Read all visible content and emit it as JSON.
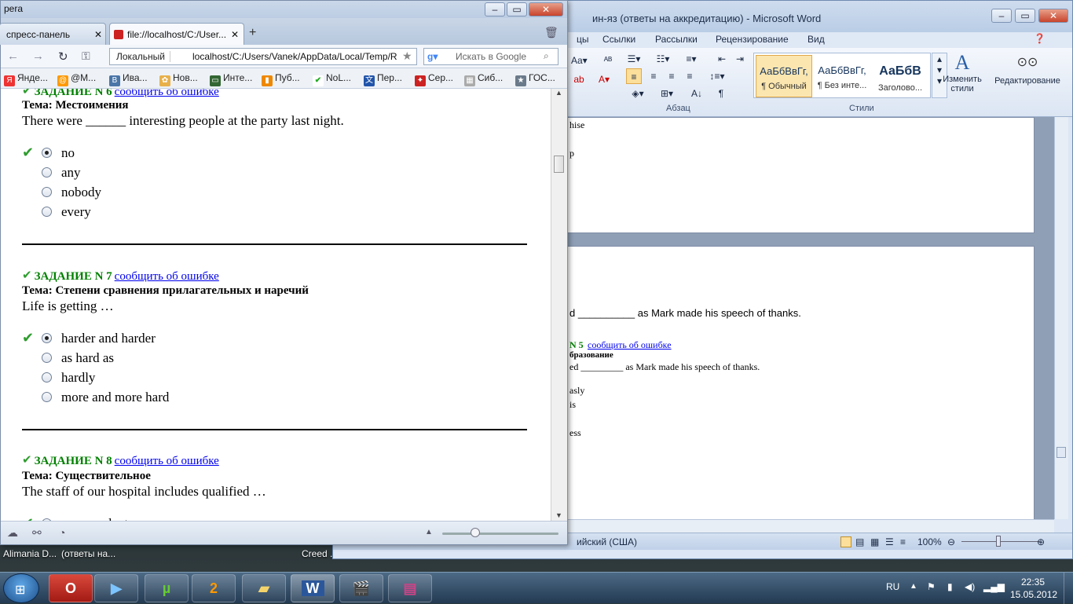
{
  "desktop": {
    "labels": [
      "Alimania D...",
      "(ответы на...",
      "Creed ..."
    ]
  },
  "word": {
    "title": "ин-яз (ответы на аккредитацию)  -  Microsoft Word",
    "menu": [
      "цы",
      "Ссылки",
      "Рассылки",
      "Рецензирование",
      "Вид"
    ],
    "ribbon": {
      "paragraph_label": "Абзац",
      "styles_label": "Стили",
      "style_tiles": [
        {
          "preview": "АаБбВвГг,",
          "name": "¶ Обычный"
        },
        {
          "preview": "АаБбВвГг,",
          "name": "¶ Без инте..."
        },
        {
          "preview": "АаБбВ",
          "name": "Заголово..."
        }
      ],
      "change_styles": "Изменить стили",
      "editing": "Редактирование"
    },
    "doc": {
      "top_fragments": [
        "hise",
        "p"
      ],
      "line1": "d __________ as Mark made his speech of thanks.",
      "task_num": "N 5",
      "task_link": "сообщить об ошибке",
      "task_topic": "бразование",
      "line2": "ed _________ as Mark made his speech of thanks.",
      "frag1": "asly",
      "frag2": "is",
      "frag3": "ess"
    },
    "status": {
      "lang": "ийский (США)",
      "zoom": "100%"
    }
  },
  "opera": {
    "title": "pera",
    "tabs": [
      {
        "label": "спресс-панель"
      },
      {
        "label": "file://localhost/C:/User..."
      }
    ],
    "address": {
      "badge": "Локальный",
      "url": "localhost/C:/Users/Vanek/AppData/Local/Temp/R",
      "search_placeholder": "Искать в Google"
    },
    "bookmarks": [
      "Янде...",
      "@M...",
      "Ива...",
      "Нов...",
      "Инте...",
      "Пуб...",
      "NoL...",
      "Пер...",
      "Сер...",
      "Сиб...",
      "ГОС..."
    ],
    "report_link": "сообщить об ошибке",
    "tasks": [
      {
        "heading": "ЗАДАНИЕ N 6",
        "topic": "Тема: Местоимения",
        "question": "There were ______ interesting people at the party last night.",
        "options": [
          "no",
          "any",
          "nobody",
          "every"
        ],
        "selected": 0
      },
      {
        "heading": "ЗАДАНИЕ N 7",
        "topic": "Тема: Степени сравнения прилагательных и наречий",
        "question": "Life is getting …",
        "options": [
          "harder and harder",
          "as hard as",
          "hardly",
          "more and more hard"
        ],
        "selected": 0
      },
      {
        "heading": "ЗАДАНИЕ N 8",
        "topic": "Тема: Существительное",
        "question": "The staff of our hospital includes qualified …",
        "options": [
          "women-doctors"
        ],
        "selected": 0
      }
    ]
  },
  "tray": {
    "lang": "RU",
    "time": "22:35",
    "date": "15.05.2012"
  }
}
